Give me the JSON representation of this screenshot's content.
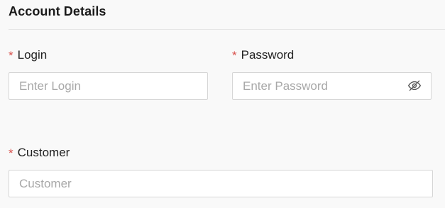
{
  "section": {
    "title": "Account Details"
  },
  "fields": {
    "login": {
      "required_mark": "*",
      "label": "Login",
      "placeholder": "Enter Login",
      "value": ""
    },
    "password": {
      "required_mark": "*",
      "label": "Password",
      "placeholder": "Enter Password",
      "value": "",
      "toggle_icon": "eye-off-icon"
    },
    "customer": {
      "required_mark": "*",
      "label": "Customer",
      "placeholder": "Customer",
      "value": ""
    }
  },
  "colors": {
    "required": "#d9534f",
    "placeholder": "#a8a8a8",
    "border": "#d6d6d6",
    "background": "#f9f9f9"
  }
}
